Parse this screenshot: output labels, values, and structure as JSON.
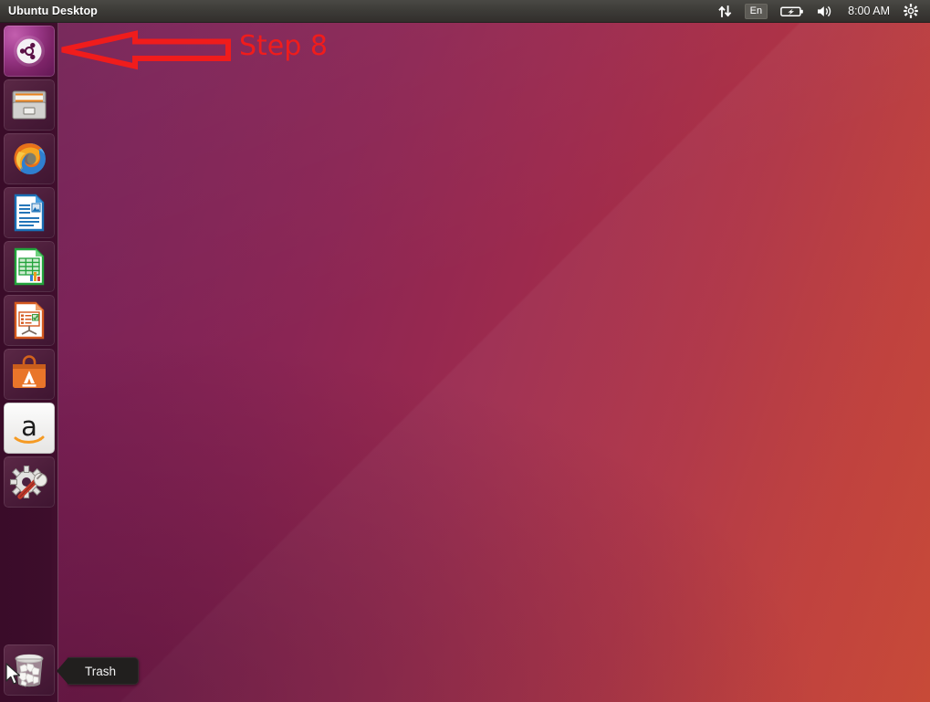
{
  "panel": {
    "title": "Ubuntu Desktop",
    "clock": "8:00 AM",
    "keyboard_layout": "En",
    "indicators": [
      {
        "name": "network-icon",
        "label": "network"
      },
      {
        "name": "keyboard-layout-indicator",
        "label": "En"
      },
      {
        "name": "battery-icon",
        "label": "battery"
      },
      {
        "name": "volume-icon",
        "label": "volume"
      },
      {
        "name": "clock-indicator",
        "label": "8:00 AM"
      },
      {
        "name": "system-menu-gear-icon",
        "label": "system menu"
      }
    ],
    "bg_color": "#3c3b37",
    "text_color": "#ffffff"
  },
  "launcher": {
    "bg_color": "#3d0d2b",
    "items": [
      {
        "name": "dash-home",
        "label": "Dash home"
      },
      {
        "name": "files",
        "label": "Files"
      },
      {
        "name": "firefox",
        "label": "Firefox Web Browser"
      },
      {
        "name": "libreoffice-writer",
        "label": "LibreOffice Writer"
      },
      {
        "name": "libreoffice-calc",
        "label": "LibreOffice Calc"
      },
      {
        "name": "libreoffice-impress",
        "label": "LibreOffice Impress"
      },
      {
        "name": "ubuntu-software-center",
        "label": "Ubuntu Software Center"
      },
      {
        "name": "amazon",
        "label": "Amazon"
      },
      {
        "name": "system-settings",
        "label": "System Settings"
      }
    ],
    "trash": {
      "name": "trash",
      "label": "Trash"
    }
  },
  "tooltip": {
    "text": "Trash",
    "bg_color": "#211f1e",
    "text_color": "#f2f2f2"
  },
  "annotation": {
    "step_label": "Step 8",
    "color": "#f01c1c",
    "arrow_direction": "left"
  },
  "desktop": {
    "gradient_start": "#6d1f52",
    "gradient_end": "#c5422f"
  }
}
